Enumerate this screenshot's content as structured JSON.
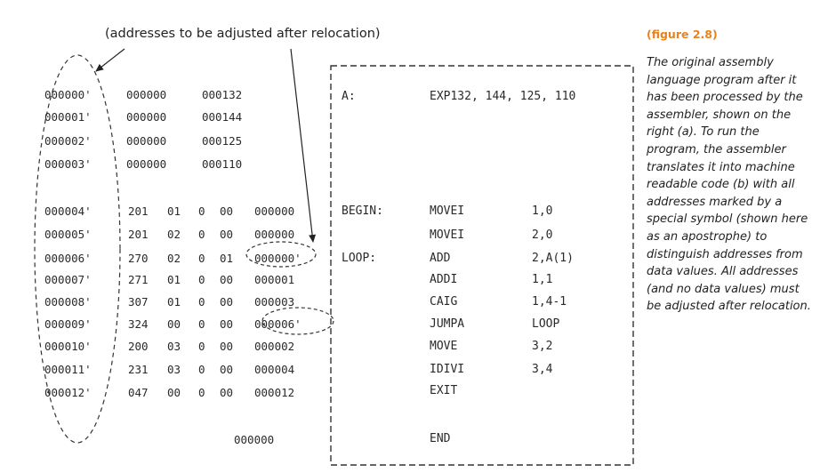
{
  "annotation": "(addresses to be adjusted after relocation)",
  "figure_label": "(figure 2.8)",
  "caption": "The original assembly language program after it has been processed by the assembler, shown on the right (a). To run the program, the assembler translates it into machine readable code (b) with all addresses marked by a special symbol (shown here as an apostrophe) to distinguish addresses from data values. All addresses (and no data values) must be adjusted after relocation.",
  "data_words": [
    {
      "addr": "000000'",
      "w1": "000000",
      "w2": "000132"
    },
    {
      "addr": "000001'",
      "w1": "000000",
      "w2": "000144"
    },
    {
      "addr": "000002'",
      "w1": "000000",
      "w2": "000125"
    },
    {
      "addr": "000003'",
      "w1": "000000",
      "w2": "000110"
    }
  ],
  "instructions": [
    {
      "addr": "000004'",
      "op": "201",
      "ac": "01",
      "i": "0",
      "x": "00",
      "y": "000000"
    },
    {
      "addr": "000005'",
      "op": "201",
      "ac": "02",
      "i": "0",
      "x": "00",
      "y": "000000"
    },
    {
      "addr": "000006'",
      "op": "270",
      "ac": "02",
      "i": "0",
      "x": "01",
      "y": "000000'"
    },
    {
      "addr": "000007'",
      "op": "271",
      "ac": "01",
      "i": "0",
      "x": "00",
      "y": "000001"
    },
    {
      "addr": "000008'",
      "op": "307",
      "ac": "01",
      "i": "0",
      "x": "00",
      "y": "000003"
    },
    {
      "addr": "000009'",
      "op": "324",
      "ac": "00",
      "i": "0",
      "x": "00",
      "y": "000006'"
    },
    {
      "addr": "000010'",
      "op": "200",
      "ac": "03",
      "i": "0",
      "x": "00",
      "y": "000002"
    },
    {
      "addr": "000011'",
      "op": "231",
      "ac": "03",
      "i": "0",
      "x": "00",
      "y": "000004"
    },
    {
      "addr": "000012'",
      "op": "047",
      "ac": "00",
      "i": "0",
      "x": "00",
      "y": "000012"
    }
  ],
  "end_word": "000000",
  "assembly": {
    "data_label": "A:",
    "data_stmt": "EXP132, 144, 125, 110",
    "lines": [
      {
        "label": "BEGIN:",
        "op": "MOVEI",
        "args": "1,0"
      },
      {
        "label": "",
        "op": "MOVEI",
        "args": "2,0"
      },
      {
        "label": "LOOP:",
        "op": "ADD",
        "args": "2,A(1)"
      },
      {
        "label": "",
        "op": "ADDI",
        "args": "1,1"
      },
      {
        "label": "",
        "op": "CAIG",
        "args": "1,4-1"
      },
      {
        "label": "",
        "op": "JUMPA",
        "args": "LOOP"
      },
      {
        "label": "",
        "op": "MOVE",
        "args": "3,2"
      },
      {
        "label": "",
        "op": "IDIVI",
        "args": "3,4"
      },
      {
        "label": "",
        "op": "EXIT",
        "args": ""
      }
    ],
    "end_op": "END"
  },
  "colors": {
    "accent": "#e8821e",
    "text": "#222222"
  }
}
